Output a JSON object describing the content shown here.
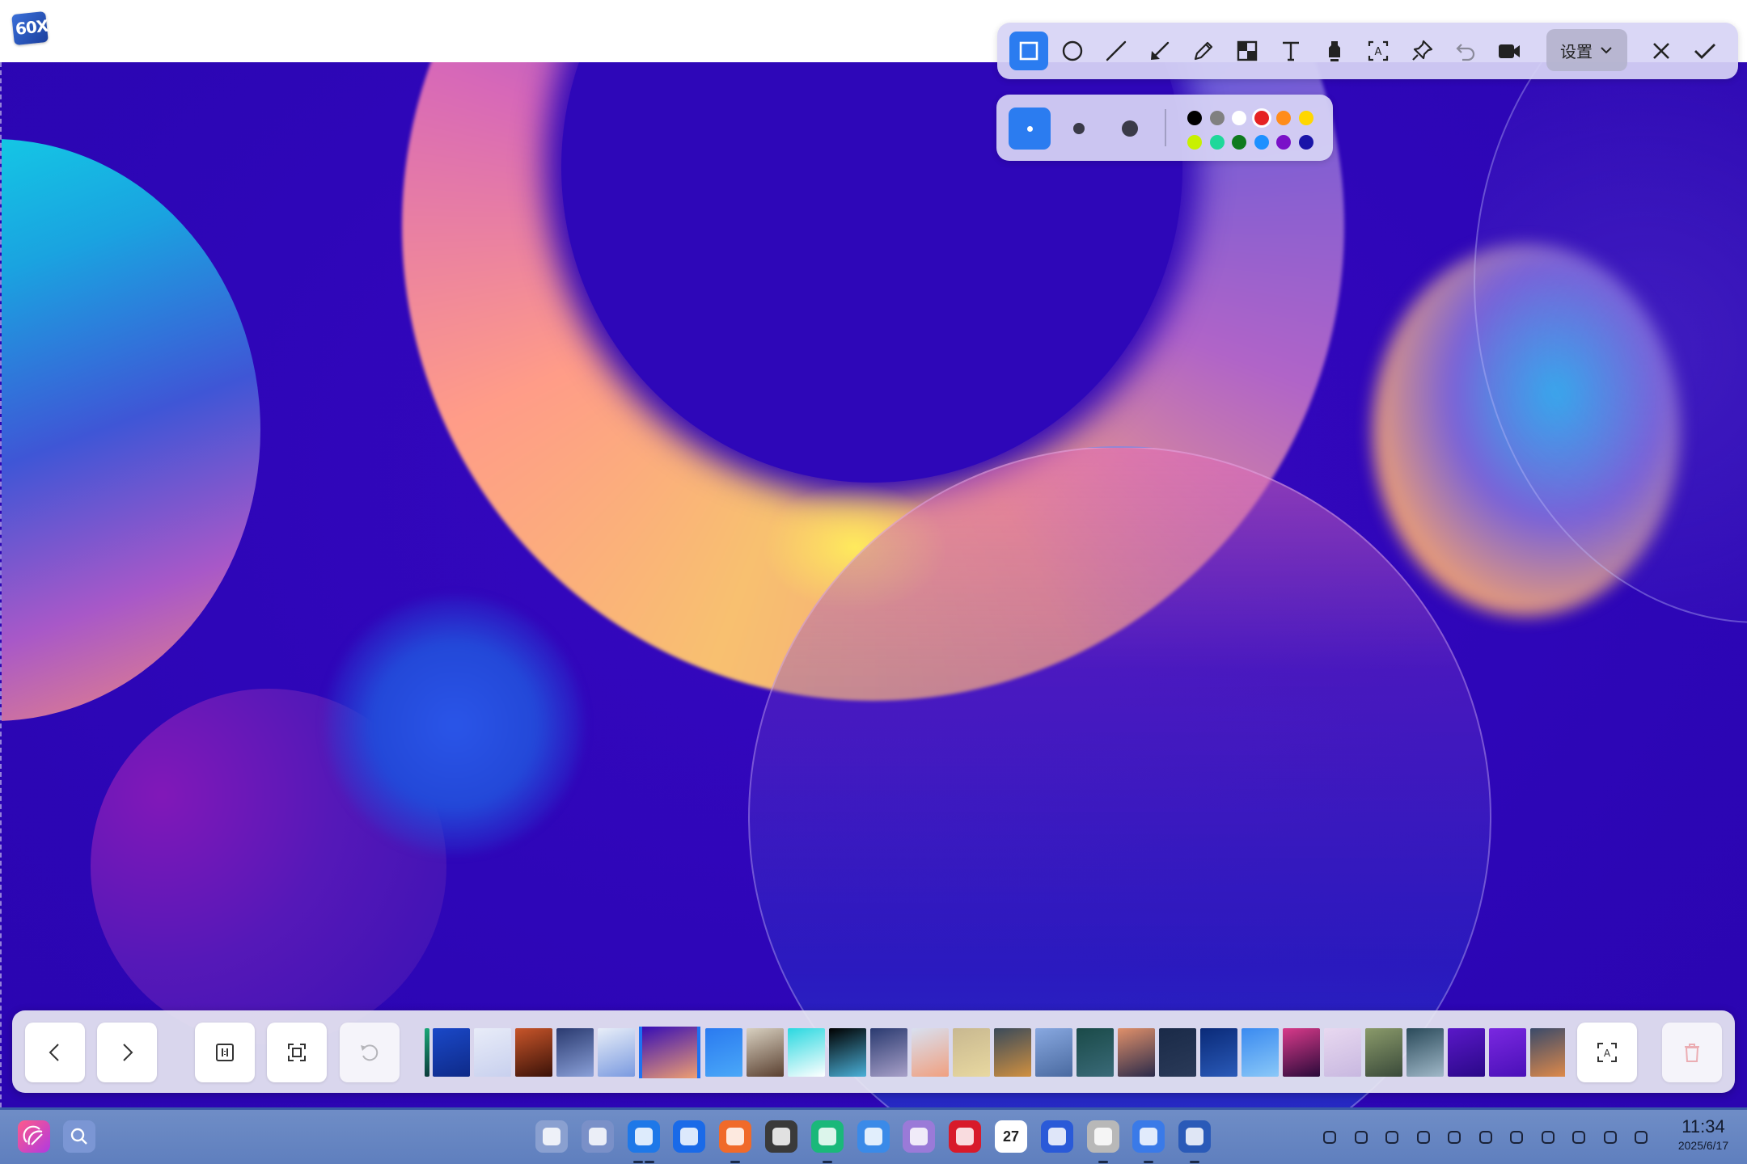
{
  "app": {
    "logo_text": "60X"
  },
  "toolbar": {
    "tools": [
      {
        "name": "rectangle-tool",
        "icon": "rectangle-icon",
        "active": true
      },
      {
        "name": "ellipse-tool",
        "icon": "ellipse-icon"
      },
      {
        "name": "line-tool",
        "icon": "line-icon"
      },
      {
        "name": "arrow-tool",
        "icon": "arrow-icon"
      },
      {
        "name": "pencil-tool",
        "icon": "pencil-icon"
      },
      {
        "name": "mosaic-tool",
        "icon": "mosaic-icon"
      },
      {
        "name": "text-tool",
        "icon": "text-icon"
      },
      {
        "name": "highlighter-tool",
        "icon": "highlighter-icon"
      },
      {
        "name": "ocr-tool",
        "icon": "ocr-icon"
      },
      {
        "name": "pin-tool",
        "icon": "pin-icon"
      },
      {
        "name": "undo-tool",
        "icon": "undo-icon"
      },
      {
        "name": "record-tool",
        "icon": "video-camera-icon"
      }
    ],
    "settings_label": "设置",
    "close_icon": "close-icon",
    "confirm_icon": "check-icon"
  },
  "options": {
    "sizes": [
      "small",
      "medium",
      "large"
    ],
    "selected_size": "small",
    "colors": [
      "#000000",
      "#808080",
      "#ffffff",
      "#e52222",
      "#ff8c1a",
      "#ffd700",
      "#c8f000",
      "#1fd89a",
      "#0e7a1e",
      "#1e90ff",
      "#7a10c8",
      "#1a14a8"
    ],
    "selected_color": "#e52222"
  },
  "viewer": {
    "buttons": [
      "previous",
      "next",
      "original-size",
      "fit-window",
      "rotate",
      "ocr",
      "delete"
    ],
    "thumbnails": [
      {
        "c1": "#1aa878",
        "c2": "#0b3a3a"
      },
      {
        "c1": "#1a48c8",
        "c2": "#0e2a88"
      },
      {
        "c1": "#e8ecf8",
        "c2": "#c8d0ee"
      },
      {
        "c1": "#c8552a",
        "c2": "#3a1208"
      },
      {
        "c1": "#2a3a70",
        "c2": "#8aa0d8"
      },
      {
        "c1": "#e8eef8",
        "c2": "#7a9ae0"
      },
      {
        "c1": "#3008b8",
        "c2": "#f0a070",
        "current": true
      },
      {
        "c1": "#2a7af0",
        "c2": "#4aa8f8"
      },
      {
        "c1": "#d8d0c0",
        "c2": "#5a4030"
      },
      {
        "c1": "#2ad8e0",
        "c2": "#ffffff"
      },
      {
        "c1": "#000000",
        "c2": "#4ab0d8"
      },
      {
        "c1": "#2a3a70",
        "c2": "#a8a0c8"
      },
      {
        "c1": "#d8e0f0",
        "c2": "#f0a080"
      },
      {
        "c1": "#c8b890",
        "c2": "#e8d8a0"
      },
      {
        "c1": "#3a4a5a",
        "c2": "#d09040"
      },
      {
        "c1": "#88a8e0",
        "c2": "#4a6aa0"
      },
      {
        "c1": "#1a4a48",
        "c2": "#3a6a78"
      },
      {
        "c1": "#e0906a",
        "c2": "#2a2a4a"
      },
      {
        "c1": "#1a2a48",
        "c2": "#2a3a58"
      },
      {
        "c1": "#0a2a78",
        "c2": "#2a5ab8"
      },
      {
        "c1": "#3a8af0",
        "c2": "#8ac8f8"
      },
      {
        "c1": "#d83a8a",
        "c2": "#2a0a3a"
      },
      {
        "c1": "#e8d8f0",
        "c2": "#c8b8e0"
      },
      {
        "c1": "#8a9a6a",
        "c2": "#3a4a3a"
      },
      {
        "c1": "#2a4a5a",
        "c2": "#a0b8c8"
      },
      {
        "c1": "#5a18c8",
        "c2": "#2a0888"
      },
      {
        "c1": "#7a28e0",
        "c2": "#4a10b8"
      },
      {
        "c1": "#3a4a6a",
        "c2": "#e08a4a"
      }
    ]
  },
  "taskbar": {
    "left_apps": [
      {
        "name": "launcher",
        "icon": "launcher-icon",
        "color": "#e84a7a"
      },
      {
        "name": "search",
        "icon": "search-icon",
        "color": "#6a8ad8"
      }
    ],
    "apps": [
      {
        "name": "multitasking",
        "icon": "grid-icon",
        "color": "#8aa0d0"
      },
      {
        "name": "app-store-alt",
        "icon": "windows-icon",
        "color": "#7a90c8"
      },
      {
        "name": "file-manager",
        "icon": "folder-icon",
        "color": "#1e78e8",
        "open": 2
      },
      {
        "name": "browser",
        "icon": "browser-icon",
        "color": "#1a6ae8"
      },
      {
        "name": "app-store",
        "icon": "store-icon",
        "color": "#f06a2a",
        "open": 1
      },
      {
        "name": "settings",
        "icon": "gear-icon",
        "color": "#3a3a3a"
      },
      {
        "name": "music",
        "icon": "music-icon",
        "color": "#1ab87a",
        "open": 1
      },
      {
        "name": "quotes",
        "icon": "quote-icon",
        "color": "#3a8ae8"
      },
      {
        "name": "mail",
        "icon": "mail-icon",
        "color": "#9a7ad8"
      },
      {
        "name": "terminal",
        "icon": "terminal-icon",
        "color": "#d81a2a"
      },
      {
        "name": "calendar",
        "icon": "calendar-icon",
        "color": "#ffffff",
        "label": "27"
      },
      {
        "name": "calculator",
        "icon": "calculator-icon",
        "color": "#2a5ad8"
      },
      {
        "name": "text-editor",
        "icon": "text-editor-icon",
        "color": "#b8b8b8",
        "open": 1
      },
      {
        "name": "screenshot",
        "icon": "screenshot-icon",
        "color": "#3a7ae8",
        "open": 1
      },
      {
        "name": "image-viewer",
        "icon": "image-viewer-icon",
        "color": "#2a5ab8",
        "open": 1
      }
    ],
    "tray": [
      "chevron-up-icon",
      "keyboard-icon",
      "bluetooth-icon",
      "battery-icon",
      "power-icon",
      "play-icon",
      "record-icon",
      "screen-capture-icon",
      "wifi-icon",
      "volume-icon",
      "toggle-icon"
    ],
    "clock": {
      "time": "11:34",
      "date": "2025/6/17"
    }
  }
}
